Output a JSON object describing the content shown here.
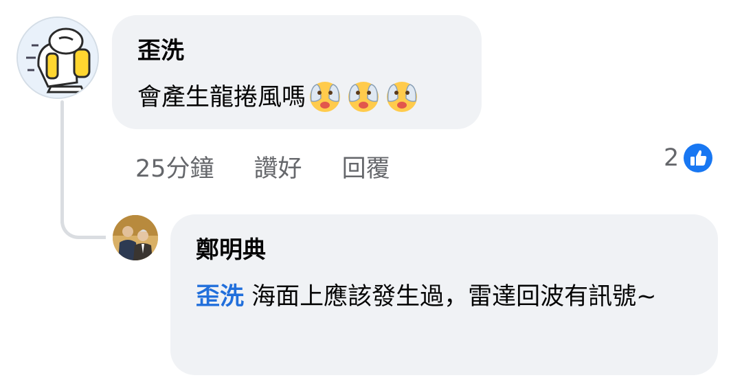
{
  "comment": {
    "author": "歪洗",
    "text": "會產生龍捲風嗎",
    "emoji_icons": [
      "hands-over-eyes-emoji",
      "hands-over-eyes-emoji",
      "hands-over-eyes-emoji"
    ],
    "time": "25分鐘",
    "like_label": "讚好",
    "reply_label": "回覆",
    "reaction_count": "2",
    "reaction_icon": "thumbs-up-icon"
  },
  "reply": {
    "author": "鄭明典",
    "mention": "歪洗",
    "text": " 海面上應該發生過，雷達回波有訊號~"
  },
  "colors": {
    "bubble_bg": "#f0f2f5",
    "mention": "#216fdb",
    "meta_text": "#65676b",
    "like_blue": "#1877f2",
    "thread_line": "#dadde1"
  }
}
